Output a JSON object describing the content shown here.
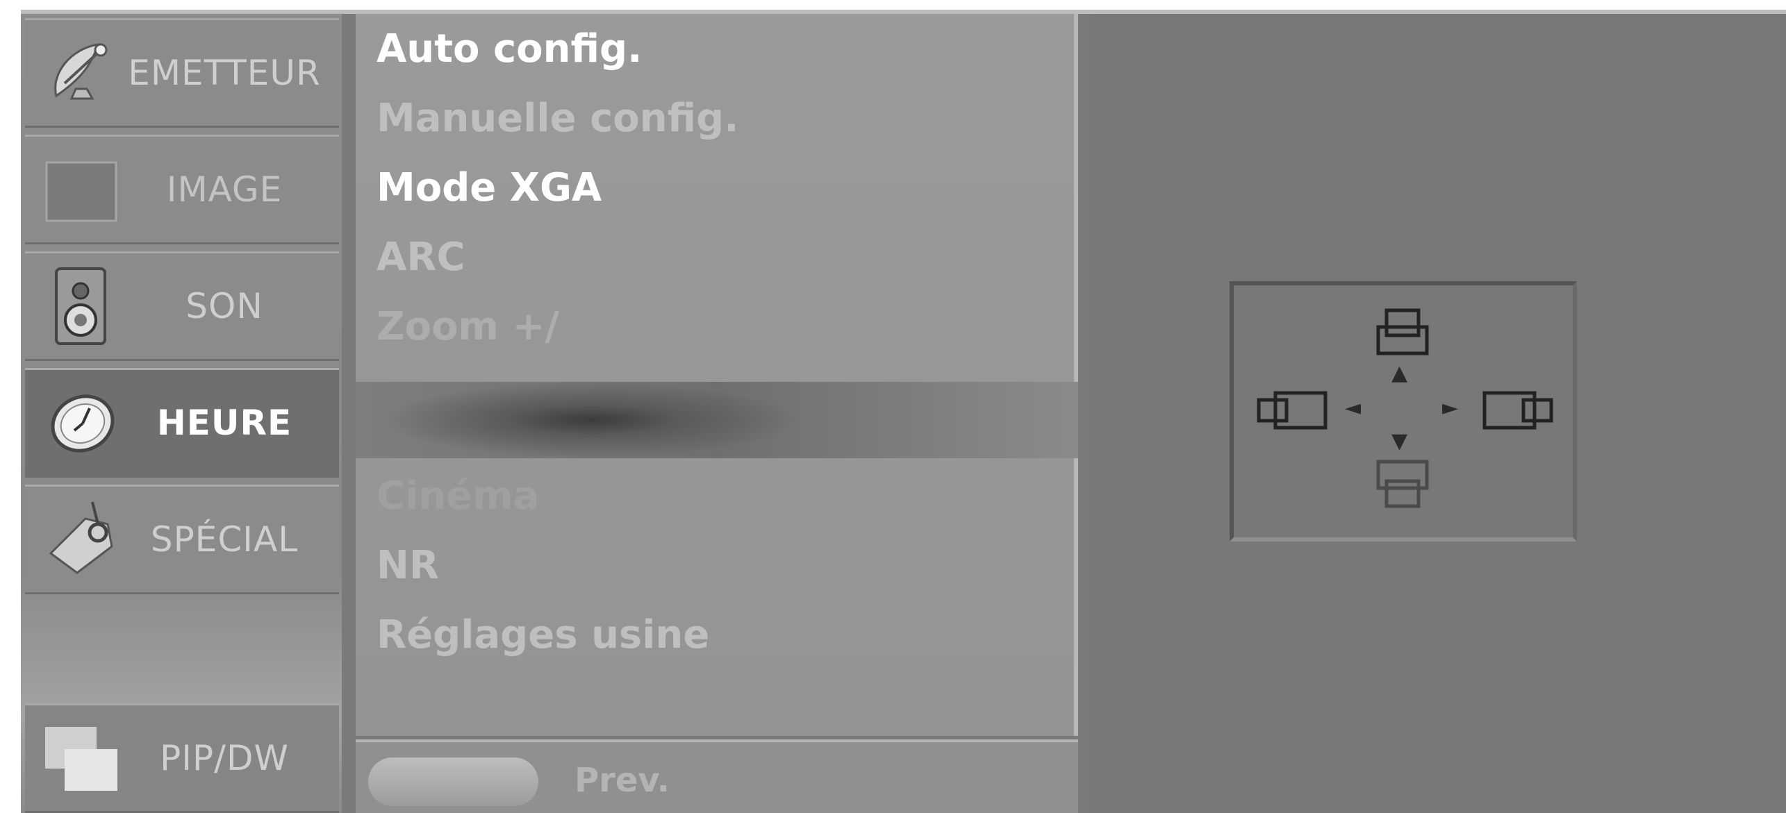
{
  "sidebar": {
    "items": [
      {
        "label": "EMETTEUR",
        "icon": "satellite-dish-icon",
        "active": false
      },
      {
        "label": "IMAGE",
        "icon": "picture-square-icon",
        "active": false
      },
      {
        "label": "SON",
        "icon": "speaker-icon",
        "active": false
      },
      {
        "label": "HEURE",
        "icon": "clock-icon",
        "active": true
      },
      {
        "label": "SPÉCIAL",
        "icon": "tag-icon",
        "active": false
      }
    ],
    "pip": {
      "label": "PIP/DW",
      "icon": "pip-windows-icon"
    }
  },
  "menu": {
    "items": [
      {
        "label": "Auto config.",
        "state": "normal"
      },
      {
        "label": "Manuelle config.",
        "state": "normal"
      },
      {
        "label": "Mode XGA",
        "state": "normal"
      },
      {
        "label": "ARC",
        "state": "dim"
      },
      {
        "label": "Zoom +/",
        "state": "faint"
      },
      {
        "label": "Cinéma",
        "state": "ghost"
      },
      {
        "label": "NR",
        "state": "dim"
      },
      {
        "label": "Réglages usine",
        "state": "normal"
      }
    ],
    "selected_index": 5
  },
  "bottom_bar": {
    "prev_label": "Prev."
  },
  "preview": {
    "position_control": {
      "icons": [
        "position-up-icon",
        "position-down-icon",
        "position-left-icon",
        "position-right-icon"
      ],
      "arrows": [
        "▲",
        "▼",
        "◄",
        "►"
      ]
    }
  }
}
